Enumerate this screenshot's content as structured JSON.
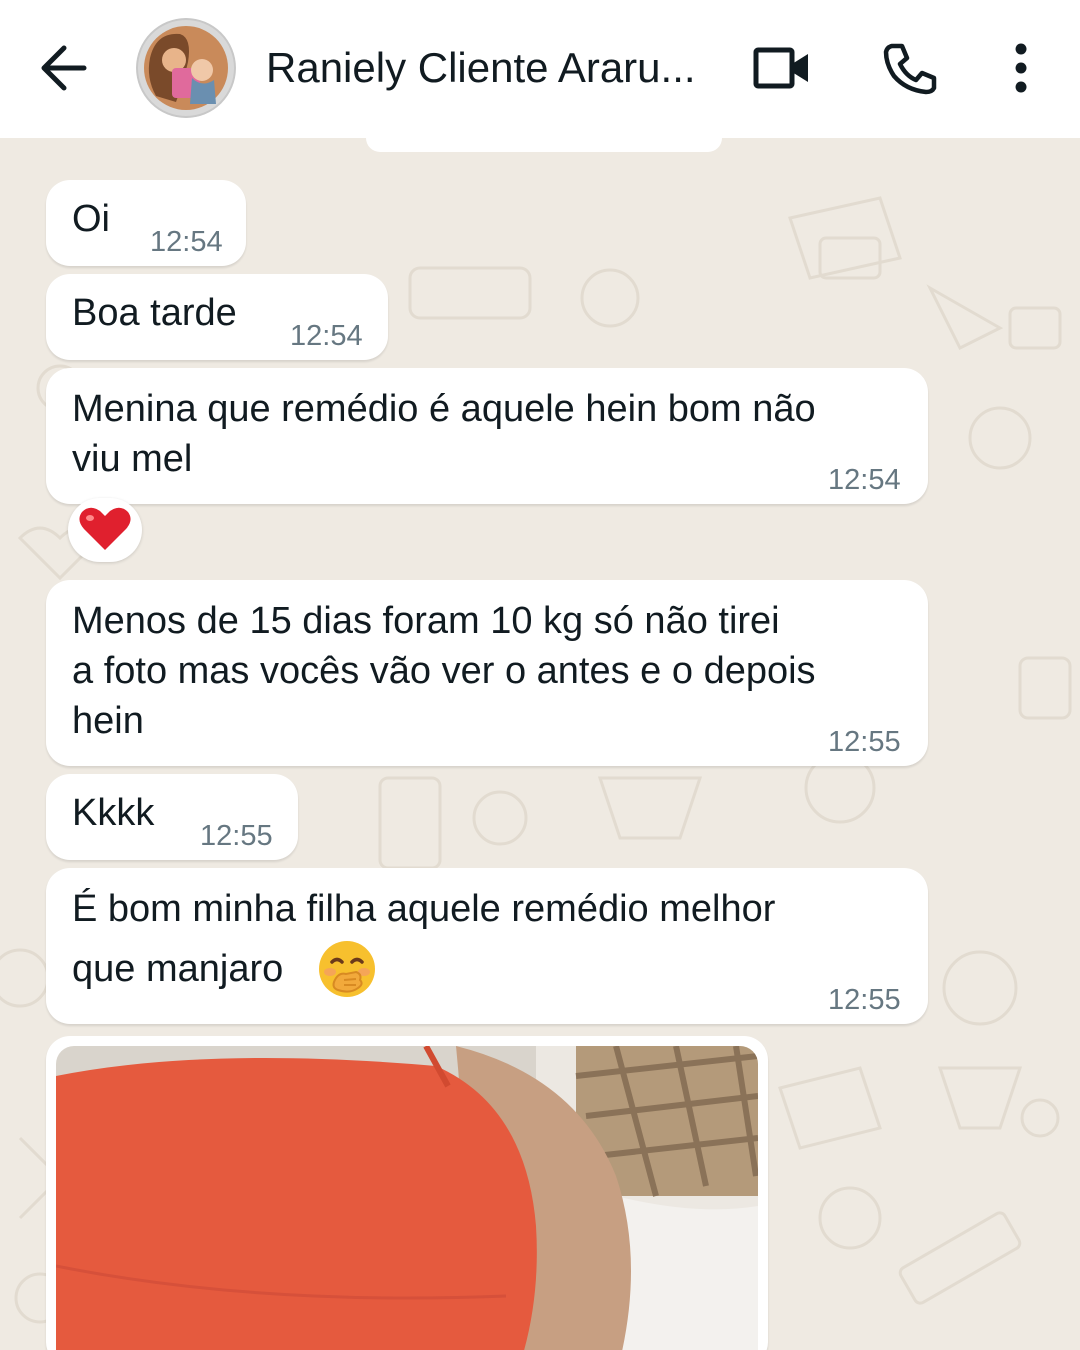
{
  "header": {
    "contact_name": "Raniely Cliente Araru...",
    "back_icon": "arrow-left-icon",
    "video_icon": "video-camera-icon",
    "call_icon": "phone-icon",
    "menu_icon": "more-vertical-icon"
  },
  "messages": [
    {
      "lines": [
        "Oi"
      ],
      "time": "12:54"
    },
    {
      "lines": [
        "Boa tarde"
      ],
      "time": "12:54"
    },
    {
      "lines": [
        "Menina que remédio é aquele hein bom não",
        "viu mel"
      ],
      "time": "12:54",
      "reaction": "heart"
    },
    {
      "lines": [
        "Menos de 15 dias foram 10 kg só não tirei",
        "a foto mas vocês vão ver o antes e o depois",
        "hein"
      ],
      "time": "12:55"
    },
    {
      "lines": [
        "Kkkk"
      ],
      "time": "12:55"
    },
    {
      "lines": [
        "É bom minha filha aquele remédio melhor",
        "que manjaro"
      ],
      "time": "12:55",
      "emoji": "face-with-hand-over-mouth"
    }
  ],
  "colors": {
    "chat_background": "#efeae2",
    "bubble": "#ffffff",
    "timestamp": "#667781",
    "text": "#111b21"
  }
}
